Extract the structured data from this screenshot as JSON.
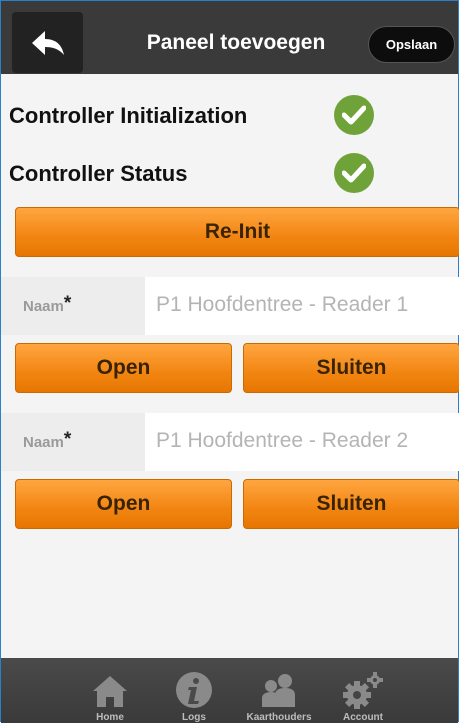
{
  "header": {
    "back_icon": "arrow-left-icon",
    "title": "Paneel toevoegen",
    "save_label": "Opslaan"
  },
  "status": [
    {
      "label": "Controller Initialization",
      "icon": "check-circle-icon",
      "state": "ok"
    },
    {
      "label": "Controller Status",
      "icon": "check-circle-icon",
      "state": "ok"
    }
  ],
  "reinit_label": "Re-Init",
  "readers": [
    {
      "name_label": "Naam",
      "required_mark": "*",
      "value": "P1 Hoofdentree - Reader 1",
      "open_label": "Open",
      "close_label": "Sluiten"
    },
    {
      "name_label": "Naam",
      "required_mark": "*",
      "value": "P1 Hoofdentree - Reader 2",
      "open_label": "Open",
      "close_label": "Sluiten"
    }
  ],
  "footer": {
    "items": [
      {
        "label": "Home",
        "icon": "home-icon"
      },
      {
        "label": "Logs",
        "icon": "info-icon"
      },
      {
        "label": "Kaarthouders",
        "icon": "users-icon"
      },
      {
        "label": "Account",
        "icon": "gear-icon"
      }
    ]
  },
  "colors": {
    "accent_orange": "#f28512",
    "check_green": "#6fa33a",
    "header_bg": "#3a3a3a"
  }
}
